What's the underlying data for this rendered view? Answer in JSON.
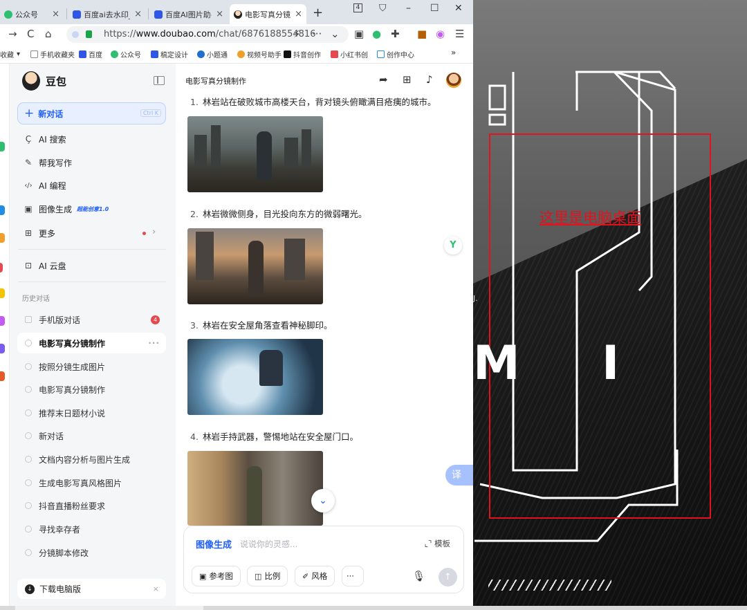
{
  "browser": {
    "tabs": [
      {
        "label": "公众号",
        "close": "×"
      },
      {
        "label": "百度ai去水印_百度",
        "close": "×"
      },
      {
        "label": "百度AI图片助手",
        "close": "×"
      },
      {
        "label": "电影写真分镜制作",
        "close": "×",
        "active": true
      }
    ],
    "tab_count": "4",
    "url_prefix": "https://",
    "url_host": "www.doubao.com",
    "url_path": "/chat/6876188554816",
    "bookmarks": [
      "收藏",
      "手机收藏夹",
      "百度",
      "公众号",
      "稿定设计",
      "小题通",
      "视频号助手",
      "抖音创作",
      "小红书创",
      "创作中心"
    ],
    "bookmarks_more": "»"
  },
  "sidebar": {
    "brand": "豆包",
    "new_chat": "新对话",
    "new_chat_shortcut": "Ctrl K",
    "menu": [
      {
        "icon": "ai-search-icon",
        "glyph": "Ç",
        "label": "AI 搜索"
      },
      {
        "icon": "writing-icon",
        "glyph": "✎",
        "label": "帮我写作"
      },
      {
        "icon": "code-icon",
        "glyph": "‹/›",
        "label": "AI 编程"
      },
      {
        "icon": "image-gen-icon",
        "glyph": "▣",
        "label": "图像生成",
        "tag": "超能创意1.0"
      },
      {
        "icon": "more-apps-icon",
        "glyph": "⊞",
        "label": "更多"
      },
      {
        "icon": "cloud-drive-icon",
        "glyph": "⊡",
        "label": "AI 云盘"
      }
    ],
    "history_title": "历史对话",
    "history": [
      {
        "label": "手机版对话",
        "badge": "4"
      },
      {
        "label": "电影写真分镜制作",
        "active": true,
        "more": "···"
      },
      {
        "label": "按照分镜生成图片"
      },
      {
        "label": "电影写真分镜制作"
      },
      {
        "label": "推荐末日题材小说"
      },
      {
        "label": "新对话"
      },
      {
        "label": "文档内容分析与图片生成"
      },
      {
        "label": "生成电影写真风格图片"
      },
      {
        "label": "抖音直播粉丝要求"
      },
      {
        "label": "寻找幸存者"
      },
      {
        "label": "分镜脚本修改"
      }
    ],
    "download": "下载电脑版",
    "download_close": "×"
  },
  "chat": {
    "title": "电影写真分镜制作",
    "steps": [
      {
        "num": "1.",
        "text": "林岩站在破败城市高楼天台，背对镜头俯瞰满目疮痍的城市。"
      },
      {
        "num": "2.",
        "text": "林岩微微侧身，目光投向东方的微弱曙光。"
      },
      {
        "num": "3.",
        "text": "林岩在安全屋角落查看神秘脚印。"
      },
      {
        "num": "4.",
        "text": "林岩手持武器，警惕地站在安全屋门口。"
      }
    ],
    "float_translate": "译",
    "composer": {
      "mode": "图像生成",
      "placeholder": "说说你的灵感...",
      "template": "模板",
      "chips": [
        "参考图",
        "比例",
        "风格",
        "···"
      ]
    }
  },
  "desktop": {
    "label": "这里是电脑桌面",
    "letter_left": "M",
    "letter_right": "I",
    "dot_text": "J."
  },
  "colors": {
    "accent": "#1f5eff",
    "desktop_box": "#e0141e"
  }
}
